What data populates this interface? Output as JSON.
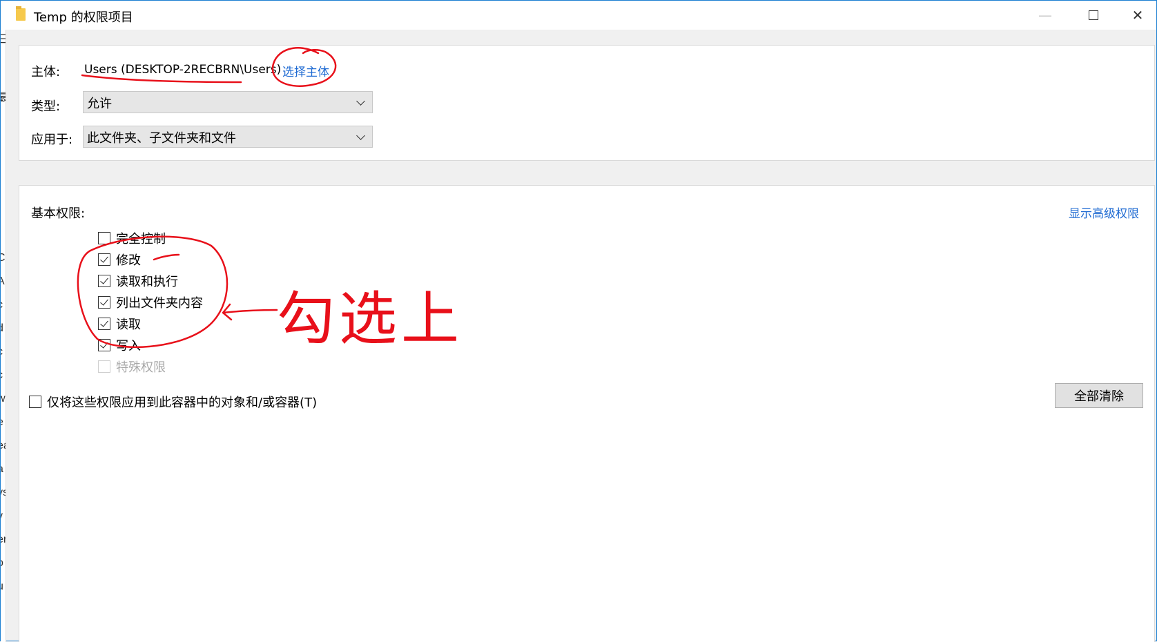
{
  "window": {
    "title": "Temp 的权限项目",
    "minimize_glyph": "—",
    "close_glyph": "✕"
  },
  "left_strip_chars": [
    "▾",
    "日",
    "最",
    "C",
    "A",
    "c",
    "d",
    "c",
    "c",
    "w",
    "e",
    "ea",
    "a",
    "ys",
    "v",
    "er",
    "o",
    "u"
  ],
  "principal": {
    "label": "主体:",
    "value": "Users (DESKTOP-2RECBRN\\Users)",
    "select_link": "选择主体"
  },
  "type_field": {
    "label": "类型:",
    "selected": "允许"
  },
  "applies_to": {
    "label": "应用于:",
    "selected": "此文件夹、子文件夹和文件"
  },
  "basic_permissions": {
    "label": "基本权限:",
    "advanced_link": "显示高级权限",
    "items": [
      {
        "label": "完全控制",
        "checked": false,
        "disabled": false
      },
      {
        "label": "修改",
        "checked": true,
        "disabled": false
      },
      {
        "label": "读取和执行",
        "checked": true,
        "disabled": false
      },
      {
        "label": "列出文件夹内容",
        "checked": true,
        "disabled": false
      },
      {
        "label": "读取",
        "checked": true,
        "disabled": false
      },
      {
        "label": "写入",
        "checked": true,
        "disabled": false
      },
      {
        "label": "特殊权限",
        "checked": false,
        "disabled": true
      }
    ]
  },
  "apply_only": {
    "label": "仅将这些权限应用到此容器中的对象和/或容器(T)",
    "checked": false
  },
  "clear_all_button": "全部清除",
  "annotation": {
    "text": "勾选上",
    "color": "#e8101a"
  }
}
